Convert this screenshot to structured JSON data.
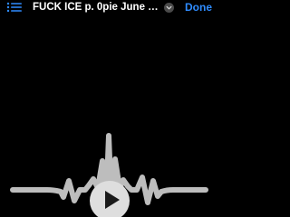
{
  "header": {
    "title": "FUCK ICE p. 0pie June 16 2...",
    "done_label": "Done",
    "list_icon": "list-icon",
    "chevron_icon": "chevron-down-circle-icon"
  },
  "player": {
    "waveform_icon": "waveform-icon",
    "play_icon": "play-icon"
  },
  "colors": {
    "background": "#000000",
    "accent": "#2f8cff",
    "waveform": "#bdbdbd",
    "play_button": "#dedede"
  }
}
